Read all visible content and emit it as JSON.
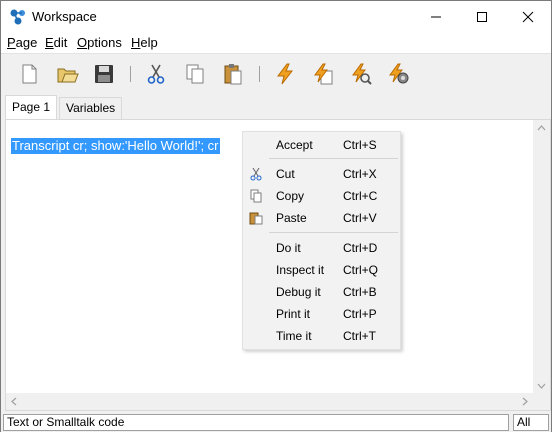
{
  "window": {
    "title": "Workspace"
  },
  "menu": {
    "page": "Page",
    "edit": "Edit",
    "options": "Options",
    "help": "Help"
  },
  "toolbar": {
    "icons": [
      "new-icon",
      "open-icon",
      "save-icon",
      "cut-icon",
      "copy-icon",
      "paste-icon",
      "do-it-icon",
      "inspect-it-icon",
      "debug-it-icon",
      "time-it-icon"
    ]
  },
  "tabs": [
    {
      "label": "Page 1",
      "active": true
    },
    {
      "label": "Variables",
      "active": false
    }
  ],
  "editor": {
    "code": "Transcript cr; show:'Hello World!'; cr",
    "selected": true,
    "selection_color": "#3399ff"
  },
  "context_menu": {
    "items": [
      {
        "label": "Accept",
        "shortcut": "Ctrl+S"
      },
      {
        "label": "Cut",
        "shortcut": "Ctrl+X",
        "icon": "cut-icon"
      },
      {
        "label": "Copy",
        "shortcut": "Ctrl+C",
        "icon": "copy-icon"
      },
      {
        "label": "Paste",
        "shortcut": "Ctrl+V",
        "icon": "paste-icon"
      },
      {
        "label": "Do it",
        "shortcut": "Ctrl+D"
      },
      {
        "label": "Inspect it",
        "shortcut": "Ctrl+Q"
      },
      {
        "label": "Debug it",
        "shortcut": "Ctrl+B"
      },
      {
        "label": "Print it",
        "shortcut": "Ctrl+P"
      },
      {
        "label": "Time it",
        "shortcut": "Ctrl+T"
      }
    ]
  },
  "status": {
    "text": "Text or Smalltalk code",
    "mode": "All"
  }
}
